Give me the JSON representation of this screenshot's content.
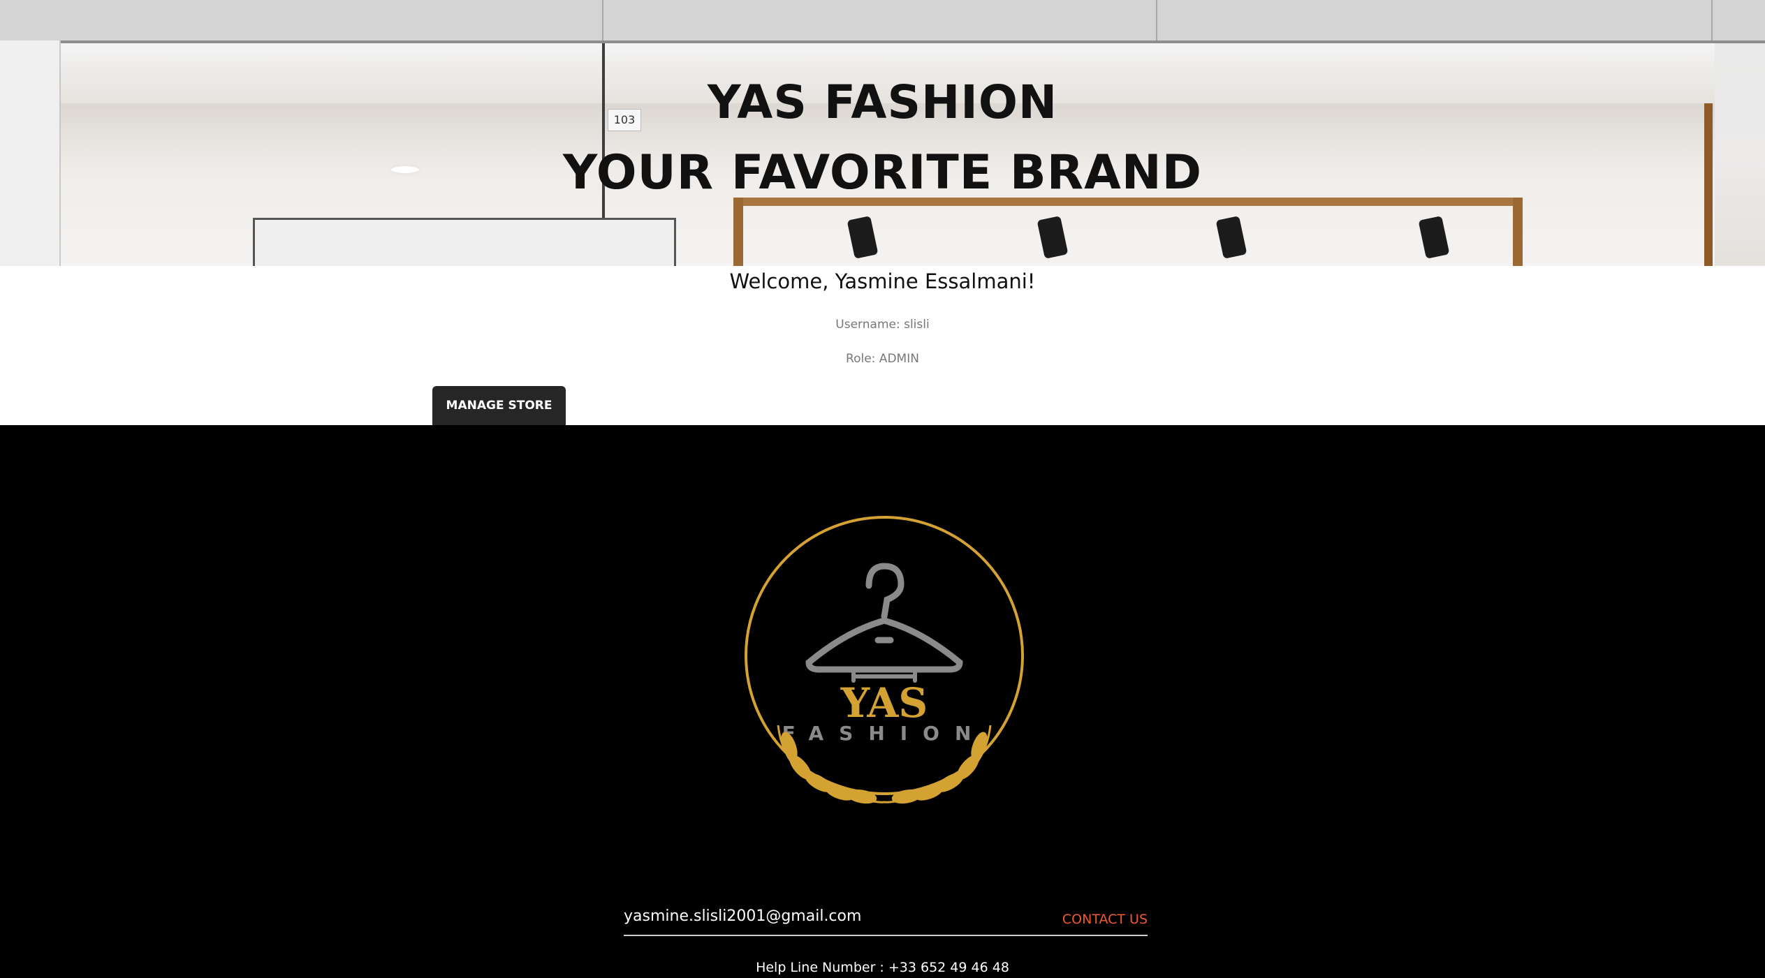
{
  "hero": {
    "title_line1": "YAS FASHION",
    "title_line2": "YOUR FAVORITE BRAND",
    "door_number": "103"
  },
  "profile": {
    "welcome": "Welcome, Yasmine Essalmani!",
    "username": "Username: slisli",
    "role": "Role: ADMIN",
    "manage_button": "MANAGE STORE"
  },
  "footer": {
    "logo": {
      "brand": "YAS",
      "sub": "FASHION",
      "ring_color": "#d4a232",
      "hanger_color": "#8a8a8a"
    },
    "email": "yasmine.slisli2001@gmail.com",
    "contact_label": "CONTACT US",
    "helpline": "Help Line Number : +33 652 49 46 48"
  },
  "colors": {
    "accent": "#f0592b",
    "gold": "#d4a232",
    "button_bg": "#262626"
  }
}
